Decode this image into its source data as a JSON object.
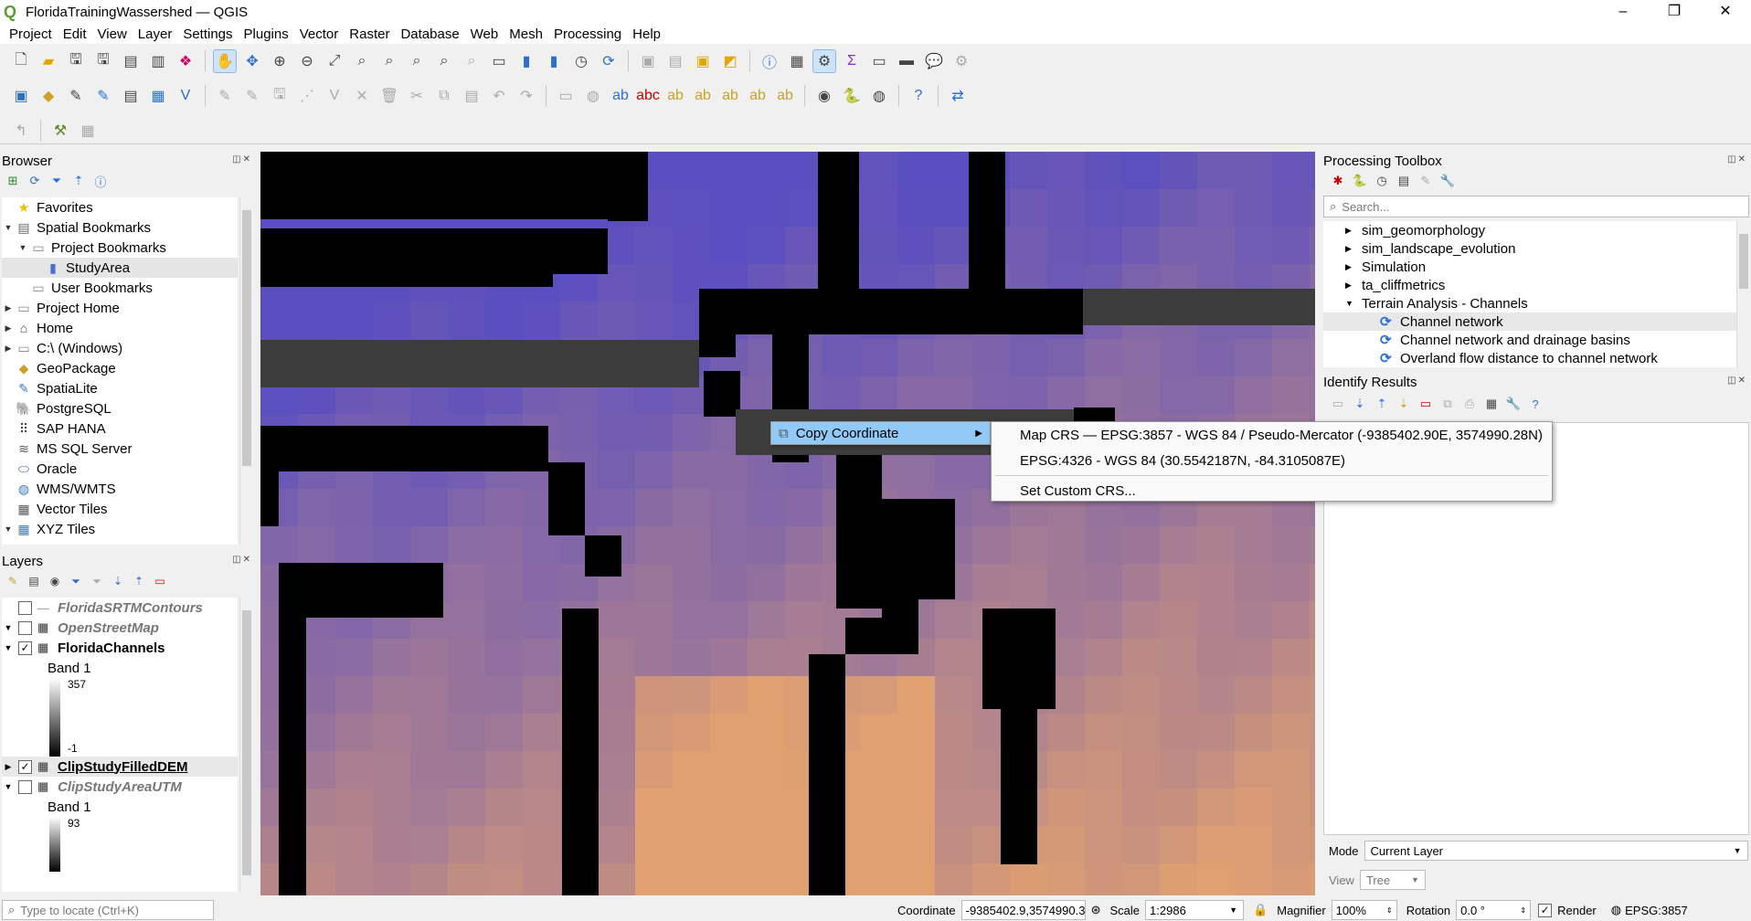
{
  "window": {
    "title": "FloridaTrainingWassershed — QGIS",
    "minimize": "–",
    "restore": "❐",
    "close": "✕"
  },
  "menu": [
    "Project",
    "Edit",
    "View",
    "Layer",
    "Settings",
    "Plugins",
    "Vector",
    "Raster",
    "Database",
    "Web",
    "Mesh",
    "Processing",
    "Help"
  ],
  "browser": {
    "title": "Browser",
    "items": [
      {
        "label": "Favorites",
        "icon": "star-icon",
        "glyph": "★",
        "color": "#e6c200",
        "indent": 0,
        "arrow": ""
      },
      {
        "label": "Spatial Bookmarks",
        "icon": "bookmarks-icon",
        "glyph": "▤",
        "color": "#666",
        "indent": 0,
        "arrow": "▼"
      },
      {
        "label": "Project Bookmarks",
        "icon": "folder-icon",
        "glyph": "▭",
        "color": "#888",
        "indent": 1,
        "arrow": "▼"
      },
      {
        "label": "StudyArea",
        "icon": "bookmark-icon",
        "glyph": "▮",
        "color": "#4a6fd0",
        "indent": 2,
        "arrow": ""
      },
      {
        "label": "User Bookmarks",
        "icon": "folder-icon",
        "glyph": "▭",
        "color": "#888",
        "indent": 1,
        "arrow": ""
      },
      {
        "label": "Project Home",
        "icon": "folder-icon",
        "glyph": "▭",
        "color": "#888",
        "indent": 0,
        "arrow": "▶"
      },
      {
        "label": "Home",
        "icon": "home-icon",
        "glyph": "⌂",
        "color": "#444",
        "indent": 0,
        "arrow": "▶"
      },
      {
        "label": "C:\\ (Windows)",
        "icon": "drive-icon",
        "glyph": "▭",
        "color": "#888",
        "indent": 0,
        "arrow": "▶"
      },
      {
        "label": "GeoPackage",
        "icon": "geopackage-icon",
        "glyph": "◆",
        "color": "#c9a227",
        "indent": 0,
        "arrow": ""
      },
      {
        "label": "SpatiaLite",
        "icon": "spatialite-icon",
        "glyph": "✎",
        "color": "#3a7ab8",
        "indent": 0,
        "arrow": ""
      },
      {
        "label": "PostgreSQL",
        "icon": "postgresql-icon",
        "glyph": "🐘",
        "color": "#336791",
        "indent": 0,
        "arrow": ""
      },
      {
        "label": "SAP HANA",
        "icon": "sap-hana-icon",
        "glyph": "⠿",
        "color": "#444",
        "indent": 0,
        "arrow": ""
      },
      {
        "label": "MS SQL Server",
        "icon": "mssql-icon",
        "glyph": "≋",
        "color": "#555",
        "indent": 0,
        "arrow": ""
      },
      {
        "label": "Oracle",
        "icon": "oracle-icon",
        "glyph": "⬭",
        "color": "#3a5aa8",
        "indent": 0,
        "arrow": ""
      },
      {
        "label": "WMS/WMTS",
        "icon": "globe-icon",
        "glyph": "◍",
        "color": "#3a7ab8",
        "indent": 0,
        "arrow": ""
      },
      {
        "label": "Vector Tiles",
        "icon": "vector-tiles-icon",
        "glyph": "▦",
        "color": "#555",
        "indent": 0,
        "arrow": ""
      },
      {
        "label": "XYZ Tiles",
        "icon": "xyz-tiles-icon",
        "glyph": "▦",
        "color": "#3a7ab8",
        "indent": 0,
        "arrow": "▼"
      }
    ]
  },
  "layers": {
    "title": "Layers",
    "items": [
      {
        "name": "FloridaSRTMContours",
        "checked": false,
        "style": "muted",
        "arrow": "",
        "icon": "line-layer-icon"
      },
      {
        "name": "OpenStreetMap",
        "checked": false,
        "style": "muted",
        "arrow": "▼",
        "icon": "raster-layer-icon"
      },
      {
        "name": "FloridaChannels",
        "checked": true,
        "style": "on",
        "arrow": "▼",
        "icon": "raster-layer-icon"
      }
    ],
    "legend1": {
      "band": "Band 1",
      "max": "357",
      "min": "-1"
    },
    "items2": [
      {
        "name": "ClipStudyFilledDEM",
        "checked": true,
        "style": "on-ul",
        "arrow": "▶",
        "icon": "raster-layer-icon"
      },
      {
        "name": "ClipStudyAreaUTM",
        "checked": false,
        "style": "muted",
        "arrow": "▼",
        "icon": "raster-layer-icon"
      }
    ],
    "legend2": {
      "band": "Band 1",
      "max": "93"
    }
  },
  "processing": {
    "title": "Processing Toolbox",
    "search_placeholder": "Search...",
    "items": [
      {
        "label": "sim_geomorphology",
        "level": 0,
        "arrow": "▶",
        "sel": false
      },
      {
        "label": "sim_landscape_evolution",
        "level": 0,
        "arrow": "▶",
        "sel": false
      },
      {
        "label": "Simulation",
        "level": 0,
        "arrow": "▶",
        "sel": false
      },
      {
        "label": "ta_cliffmetrics",
        "level": 0,
        "arrow": "▶",
        "sel": false
      },
      {
        "label": "Terrain Analysis - Channels",
        "level": 0,
        "arrow": "▼",
        "sel": false
      },
      {
        "label": "Channel network",
        "level": 1,
        "arrow": "",
        "sel": true
      },
      {
        "label": "Channel network and drainage basins",
        "level": 1,
        "arrow": "",
        "sel": false
      },
      {
        "label": "Overland flow distance to channel network",
        "level": 1,
        "arrow": "",
        "sel": false
      }
    ]
  },
  "identify": {
    "title": "Identify Results",
    "mode_label": "Mode",
    "mode_value": "Current Layer",
    "view_label": "View",
    "view_value": "Tree"
  },
  "context_menu": {
    "copy_coordinate": "Copy Coordinate",
    "submenu": [
      "Map CRS — EPSG:3857 - WGS 84 / Pseudo-Mercator (-9385402.90E, 3574990.28N)",
      "EPSG:4326 - WGS 84 (30.5542187N, -84.3105087E)",
      "Set Custom CRS..."
    ]
  },
  "status": {
    "locate_placeholder": "Type to locate (Ctrl+K)",
    "coordinate_label": "Coordinate",
    "coordinate_value": "-9385402.9,3574990.3",
    "scale_label": "Scale",
    "scale_value": "1:2986",
    "magnifier_label": "Magnifier",
    "magnifier_value": "100%",
    "rotation_label": "Rotation",
    "rotation_value": "0.0 °",
    "render_label": "Render",
    "crs": "EPSG:3857"
  },
  "colors": {
    "accent": "#91c9f7",
    "channel": "#000000",
    "low": "#5a4ec0",
    "high": "#e0a070",
    "nodata": "#3c3c3c"
  }
}
